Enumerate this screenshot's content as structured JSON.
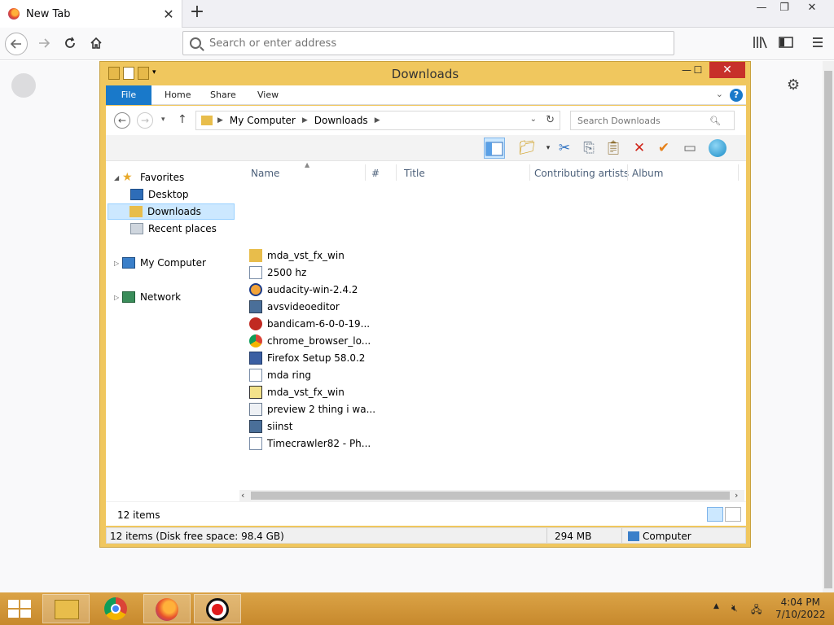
{
  "browser": {
    "tab_title": "New Tab",
    "tab_close": "✕",
    "new_tab": "+",
    "url_placeholder": "Search or enter address",
    "win_minimize": "—",
    "win_restore": "❐",
    "win_close": "✕"
  },
  "explorer": {
    "title": "Downloads",
    "win_minimize": "—",
    "win_maximize": "☐",
    "win_close": "✕",
    "ribbon_tabs": [
      "File",
      "Home",
      "Share",
      "View"
    ],
    "help": "?",
    "address": [
      "My Computer",
      "Downloads"
    ],
    "search_placeholder": "Search Downloads",
    "nav": {
      "favorites": "Favorites",
      "desktop": "Desktop",
      "downloads": "Downloads",
      "recent": "Recent places",
      "computer": "My Computer",
      "network": "Network"
    },
    "columns": [
      "Name",
      "#",
      "Title",
      "Contributing artists",
      "Album"
    ],
    "files": [
      {
        "name": "mda_vst_fx_win",
        "icon": "folder-icon"
      },
      {
        "name": "2500 hz",
        "icon": "audio-file-icon"
      },
      {
        "name": "audacity-win-2.4.2",
        "icon": "audacity-icon"
      },
      {
        "name": "avsvideoeditor",
        "icon": "installer-icon"
      },
      {
        "name": "bandicam-6-0-0-19...",
        "icon": "bandicam-icon"
      },
      {
        "name": "chrome_browser_lo...",
        "icon": "chrome-icon"
      },
      {
        "name": "Firefox Setup 58.0.2",
        "icon": "firefox-setup-icon"
      },
      {
        "name": "mda ring",
        "icon": "audio-file-icon"
      },
      {
        "name": "mda_vst_fx_win",
        "icon": "zip-icon"
      },
      {
        "name": "preview 2 thing i wa...",
        "icon": "document-icon"
      },
      {
        "name": "siinst",
        "icon": "installer-icon"
      },
      {
        "name": "Timecrawler82 - Ph...",
        "icon": "audio-file-icon"
      }
    ],
    "item_count": "12 items",
    "status_left": "12 items (Disk free space: 98.4 GB)",
    "status_size": "294 MB",
    "status_location": "Computer"
  },
  "taskbar": {
    "time": "4:04 PM",
    "date": "7/10/2022"
  },
  "colors": {
    "explorer_frame": "#f0c75e",
    "file_tab": "#1979ca",
    "selection": "#cce8ff",
    "taskbar": "#d39a3f",
    "close_red": "#c7302a"
  }
}
